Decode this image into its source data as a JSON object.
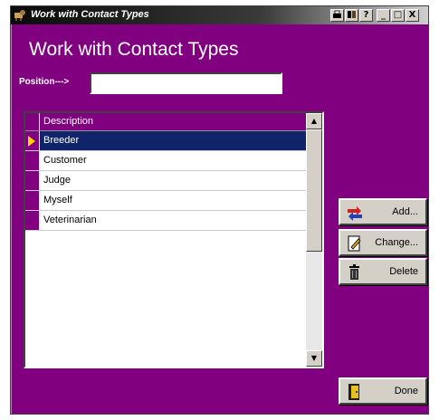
{
  "window": {
    "title": "Work with Contact Types",
    "title_buttons": [
      "?",
      "_",
      "□",
      "X"
    ]
  },
  "heading": "Work with Contact Types",
  "position": {
    "label": "Position--->",
    "value": "",
    "placeholder": ""
  },
  "grid": {
    "column_header": "Description",
    "rows": [
      "Breeder",
      "Customer",
      "Judge",
      "Myself",
      "Veterinarian"
    ],
    "selected_index": 0
  },
  "buttons": {
    "add": "Add...",
    "change": "Change...",
    "delete": "Delete",
    "done": "Done"
  },
  "colors": {
    "window_bg": "#800080",
    "selection": "#10246a",
    "button_face": "#d4d0c8"
  }
}
